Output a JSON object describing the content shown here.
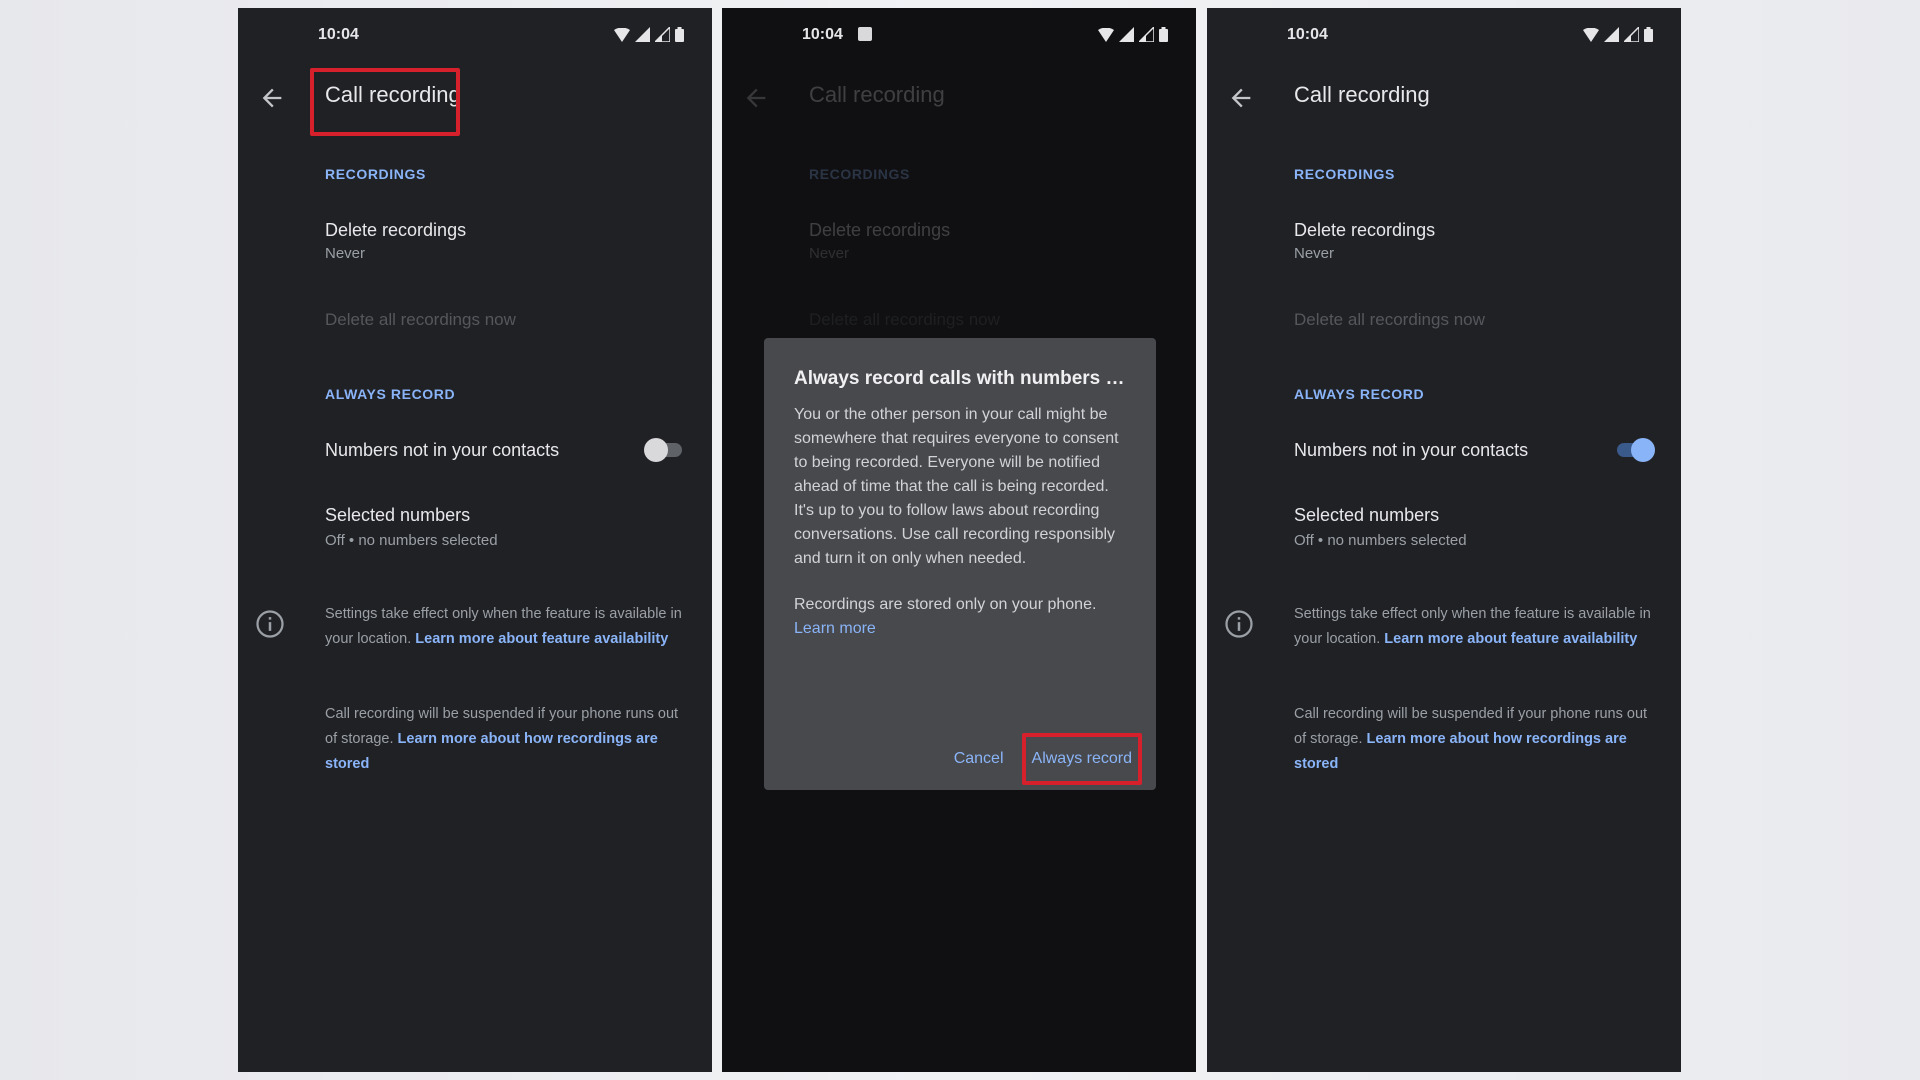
{
  "status": {
    "time": "10:04"
  },
  "screen": {
    "title": "Call recording",
    "recordings_header": "RECORDINGS",
    "delete_recordings_title": "Delete recordings",
    "delete_recordings_sub": "Never",
    "delete_all_now": "Delete all recordings now",
    "always_record_header": "ALWAYS RECORD",
    "numbers_not_in_contacts": "Numbers not in your contacts",
    "selected_numbers_title": "Selected numbers",
    "selected_numbers_sub": "Off • no numbers selected",
    "note1_text": "Settings take effect only when the feature is available in your location.",
    "note1_link": "Learn more about feature availability",
    "note2_text": "Call recording will be suspended if your phone runs out of storage.",
    "note2_link": "Learn more about how recordings are stored"
  },
  "toggles": {
    "phone1": "off",
    "phone3": "on"
  },
  "dialog": {
    "title": "Always record calls with numbers that are not in your co...",
    "body": "You or the other person in your call might be somewhere that requires everyone to consent to being recorded. Everyone will be notified ahead of time that the call is being recorded. It's up to you to follow laws about recording conversations. Use call recording responsibly and turn it on only when needed.",
    "body2_text": "Recordings are stored only on your phone.",
    "body2_link": "Learn more",
    "cancel": "Cancel",
    "confirm": "Always record"
  },
  "colors": {
    "highlight": "#d6202c",
    "accent": "#8ab4f8",
    "background": "#202125"
  }
}
